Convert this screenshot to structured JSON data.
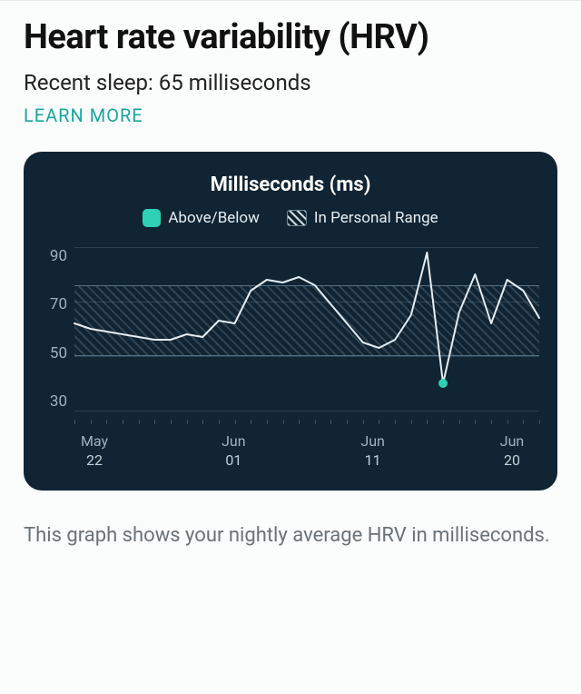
{
  "title": "Heart rate variability (HRV)",
  "subtitle": "Recent sleep: 65 milliseconds",
  "learn_more": "LEARN MORE",
  "card": {
    "title": "Milliseconds (ms)",
    "legend": {
      "above_below": "Above/Below",
      "in_range": "In Personal Range"
    }
  },
  "caption": "This graph shows your nightly average HRV in milliseconds.",
  "chart_data": {
    "type": "line",
    "ylabel": "Milliseconds (ms)",
    "ylim": [
      30,
      90
    ],
    "y_ticks": [
      90,
      70,
      50,
      30
    ],
    "personal_range": [
      50,
      76
    ],
    "x": [
      0,
      1,
      2,
      3,
      4,
      5,
      6,
      7,
      8,
      9,
      10,
      11,
      12,
      13,
      14,
      15,
      16,
      17,
      18,
      19,
      20,
      21,
      22,
      23,
      24,
      25,
      26,
      27,
      28,
      29
    ],
    "values": [
      62,
      60,
      59,
      58,
      57,
      56,
      56,
      58,
      57,
      63,
      62,
      74,
      78,
      77,
      79,
      76,
      69,
      62,
      55,
      53,
      56,
      65,
      88,
      40,
      66,
      80,
      62,
      78,
      74,
      64
    ],
    "marker_index": 23,
    "x_tick_labels": [
      {
        "month": "May",
        "day": "22"
      },
      {
        "month": "Jun",
        "day": "01"
      },
      {
        "month": "Jun",
        "day": "11"
      },
      {
        "month": "Jun",
        "day": "20"
      }
    ]
  }
}
